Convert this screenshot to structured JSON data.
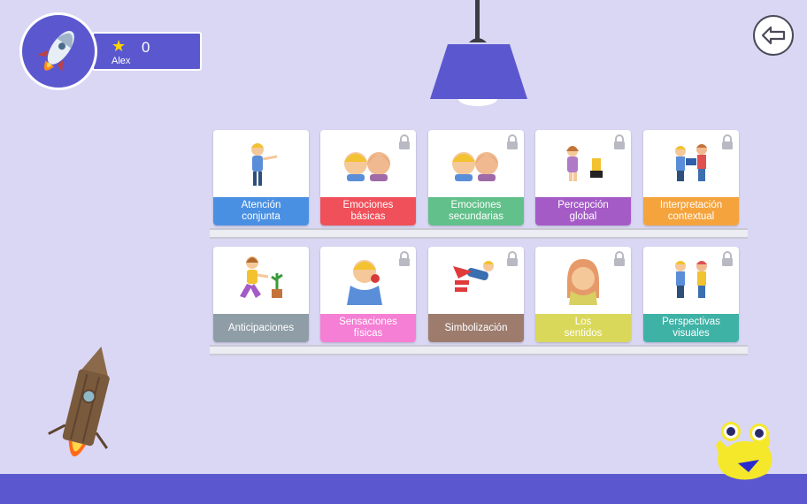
{
  "profile": {
    "score": "0",
    "name": "Alex",
    "star_icon": "star-icon",
    "avatar_icon": "rocket-icon"
  },
  "navigation": {
    "back_icon": "arrow-left-icon"
  },
  "colors": {
    "background": "#d9d7f3",
    "accent": "#5b58cf"
  },
  "shelves": [
    {
      "cards": [
        {
          "label": "Atención\nconjunta",
          "color": "#4a90e2",
          "locked": false
        },
        {
          "label": "Emociones\nbásicas",
          "color": "#f0505a",
          "locked": true
        },
        {
          "label": "Emociones\nsecundarias",
          "color": "#62c08a",
          "locked": true
        },
        {
          "label": "Percepción\nglobal",
          "color": "#a45bc6",
          "locked": true
        },
        {
          "label": "Interpretación\ncontextual",
          "color": "#f5a33c",
          "locked": true
        }
      ]
    },
    {
      "cards": [
        {
          "label": "Anticipaciones",
          "color": "#8f9ea6",
          "locked": false
        },
        {
          "label": "Sensaciones\nfísicas",
          "color": "#f57fd4",
          "locked": true
        },
        {
          "label": "Simbolización",
          "color": "#9d7c6e",
          "locked": true
        },
        {
          "label": "Los\nsentidos",
          "color": "#d9d85a",
          "locked": true
        },
        {
          "label": "Perspectivas\nvisuales",
          "color": "#3fb2a6",
          "locked": true
        }
      ]
    }
  ]
}
